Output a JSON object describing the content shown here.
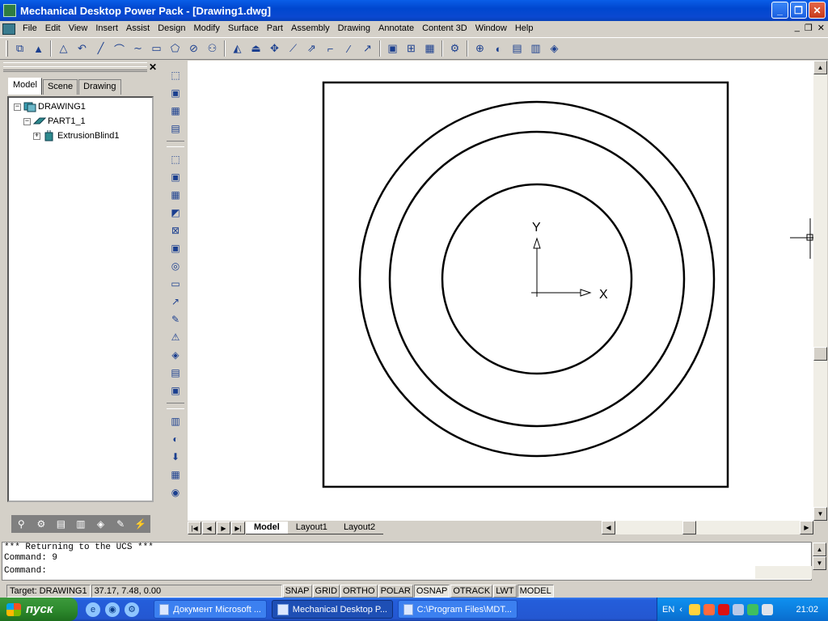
{
  "window": {
    "title": "Mechanical Desktop Power Pack - [Drawing1.dwg]",
    "controls": {
      "minimize": "_",
      "maximize": "❐",
      "close": "✕"
    }
  },
  "menubar": {
    "items": [
      "File",
      "Edit",
      "View",
      "Insert",
      "Assist",
      "Design",
      "Modify",
      "Surface",
      "Part",
      "Assembly",
      "Drawing",
      "Annotate",
      "Content 3D",
      "Window",
      "Help"
    ],
    "mdi_controls": {
      "minimize": "_",
      "restore": "❐",
      "close": "✕"
    }
  },
  "toolbar": {
    "buttons": [
      "⧉",
      "▲",
      "△",
      "↶",
      "╱",
      "⌒",
      "∼",
      "▭",
      "⬠",
      "⊘",
      "⚇",
      "◭",
      "⏏",
      "✥",
      "⟋",
      "⇗",
      "⌐",
      "⁄",
      "↗",
      "▣",
      "⊞",
      "▦",
      "⚙",
      "⊕",
      "◐",
      "▤",
      "▥",
      "◈"
    ]
  },
  "browser": {
    "close": "✕",
    "tabs": [
      "Model",
      "Scene",
      "Drawing"
    ],
    "tree": [
      {
        "label": "DRAWING1",
        "expander": "−"
      },
      {
        "label": "PART1_1",
        "expander": "−"
      },
      {
        "label": "ExtrusionBlind1",
        "expander": "+"
      }
    ],
    "bottom_icons": [
      "⚲",
      "⚙",
      "▤",
      "▥",
      "◈",
      "✎",
      "⚡"
    ]
  },
  "vtoolbar": {
    "buttons": [
      "⬚",
      "▣",
      "▦",
      "▤",
      "⬚",
      "▣",
      "▦",
      "◩",
      "⊠",
      "▣",
      "◎",
      "▭",
      "↗",
      "✎",
      "⚠",
      "◈",
      "▤",
      "▣",
      "▥",
      "◐",
      "⬇",
      "▦",
      "◉"
    ]
  },
  "drawing": {
    "ucs": {
      "x_label": "X",
      "y_label": "Y"
    }
  },
  "layout_tabs": [
    "Model",
    "Layout1",
    "Layout2"
  ],
  "command": {
    "lines": [
      "*** Returning to the UCS ***",
      "Command: 9",
      "Command:"
    ]
  },
  "status": {
    "target": "Target: DRAWING1",
    "coords": "37.17, 7.48, 0.00",
    "toggles": [
      "SNAP",
      "GRID",
      "ORTHO",
      "POLAR",
      "OSNAP",
      "OTRACK",
      "LWT",
      "MODEL"
    ],
    "pressed": [
      "OSNAP",
      "MODEL"
    ]
  },
  "taskbar": {
    "start": "пуск",
    "tasks": [
      {
        "label": "Документ Microsoft ...",
        "active": false
      },
      {
        "label": "Mechanical Desktop P...",
        "active": true
      },
      {
        "label": "C:\\Program Files\\MDT...",
        "active": false
      }
    ],
    "lang": "EN",
    "clock": "21:02"
  }
}
